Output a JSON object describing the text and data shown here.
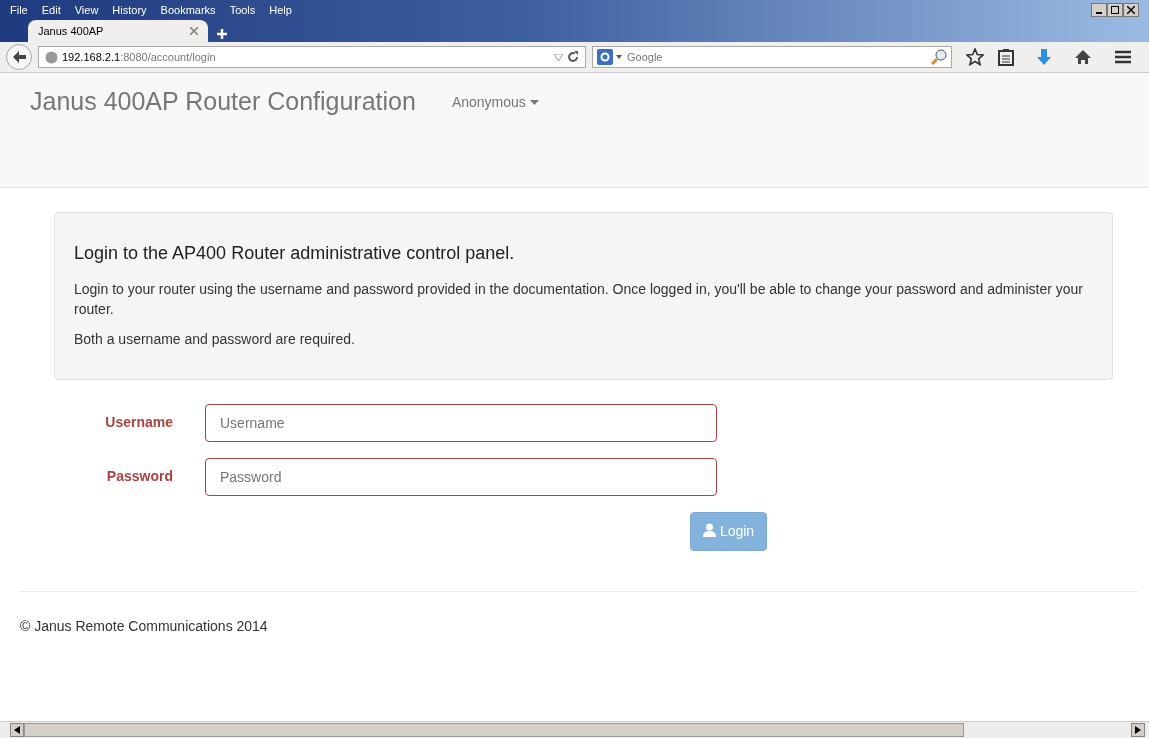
{
  "browser": {
    "menu": [
      "File",
      "Edit",
      "View",
      "History",
      "Bookmarks",
      "Tools",
      "Help"
    ],
    "tabs": [
      {
        "title": "Janus 400AP",
        "selected": true
      }
    ],
    "address": {
      "host": "192.168.2.1",
      "path": ":8080/account/login"
    },
    "search": {
      "placeholder": "Google"
    }
  },
  "navbar": {
    "brand": "Janus 400AP Router Configuration",
    "user_menu": "Anonymous"
  },
  "intro": {
    "heading": "Login to the AP400 Router administrative control panel.",
    "paragraphs": [
      "Login to your router using the username and password provided in the documentation. Once logged in, you'll be able to change your password and administer your router.",
      "Both a username and password are required."
    ]
  },
  "form": {
    "fields": [
      {
        "label": "Username",
        "placeholder": "Username",
        "invalid": true
      },
      {
        "label": "Password",
        "placeholder": "Password",
        "invalid": true
      }
    ],
    "submit": {
      "label": "Login",
      "disabled": true
    }
  },
  "footer": "© Janus Remote Communications 2014"
}
